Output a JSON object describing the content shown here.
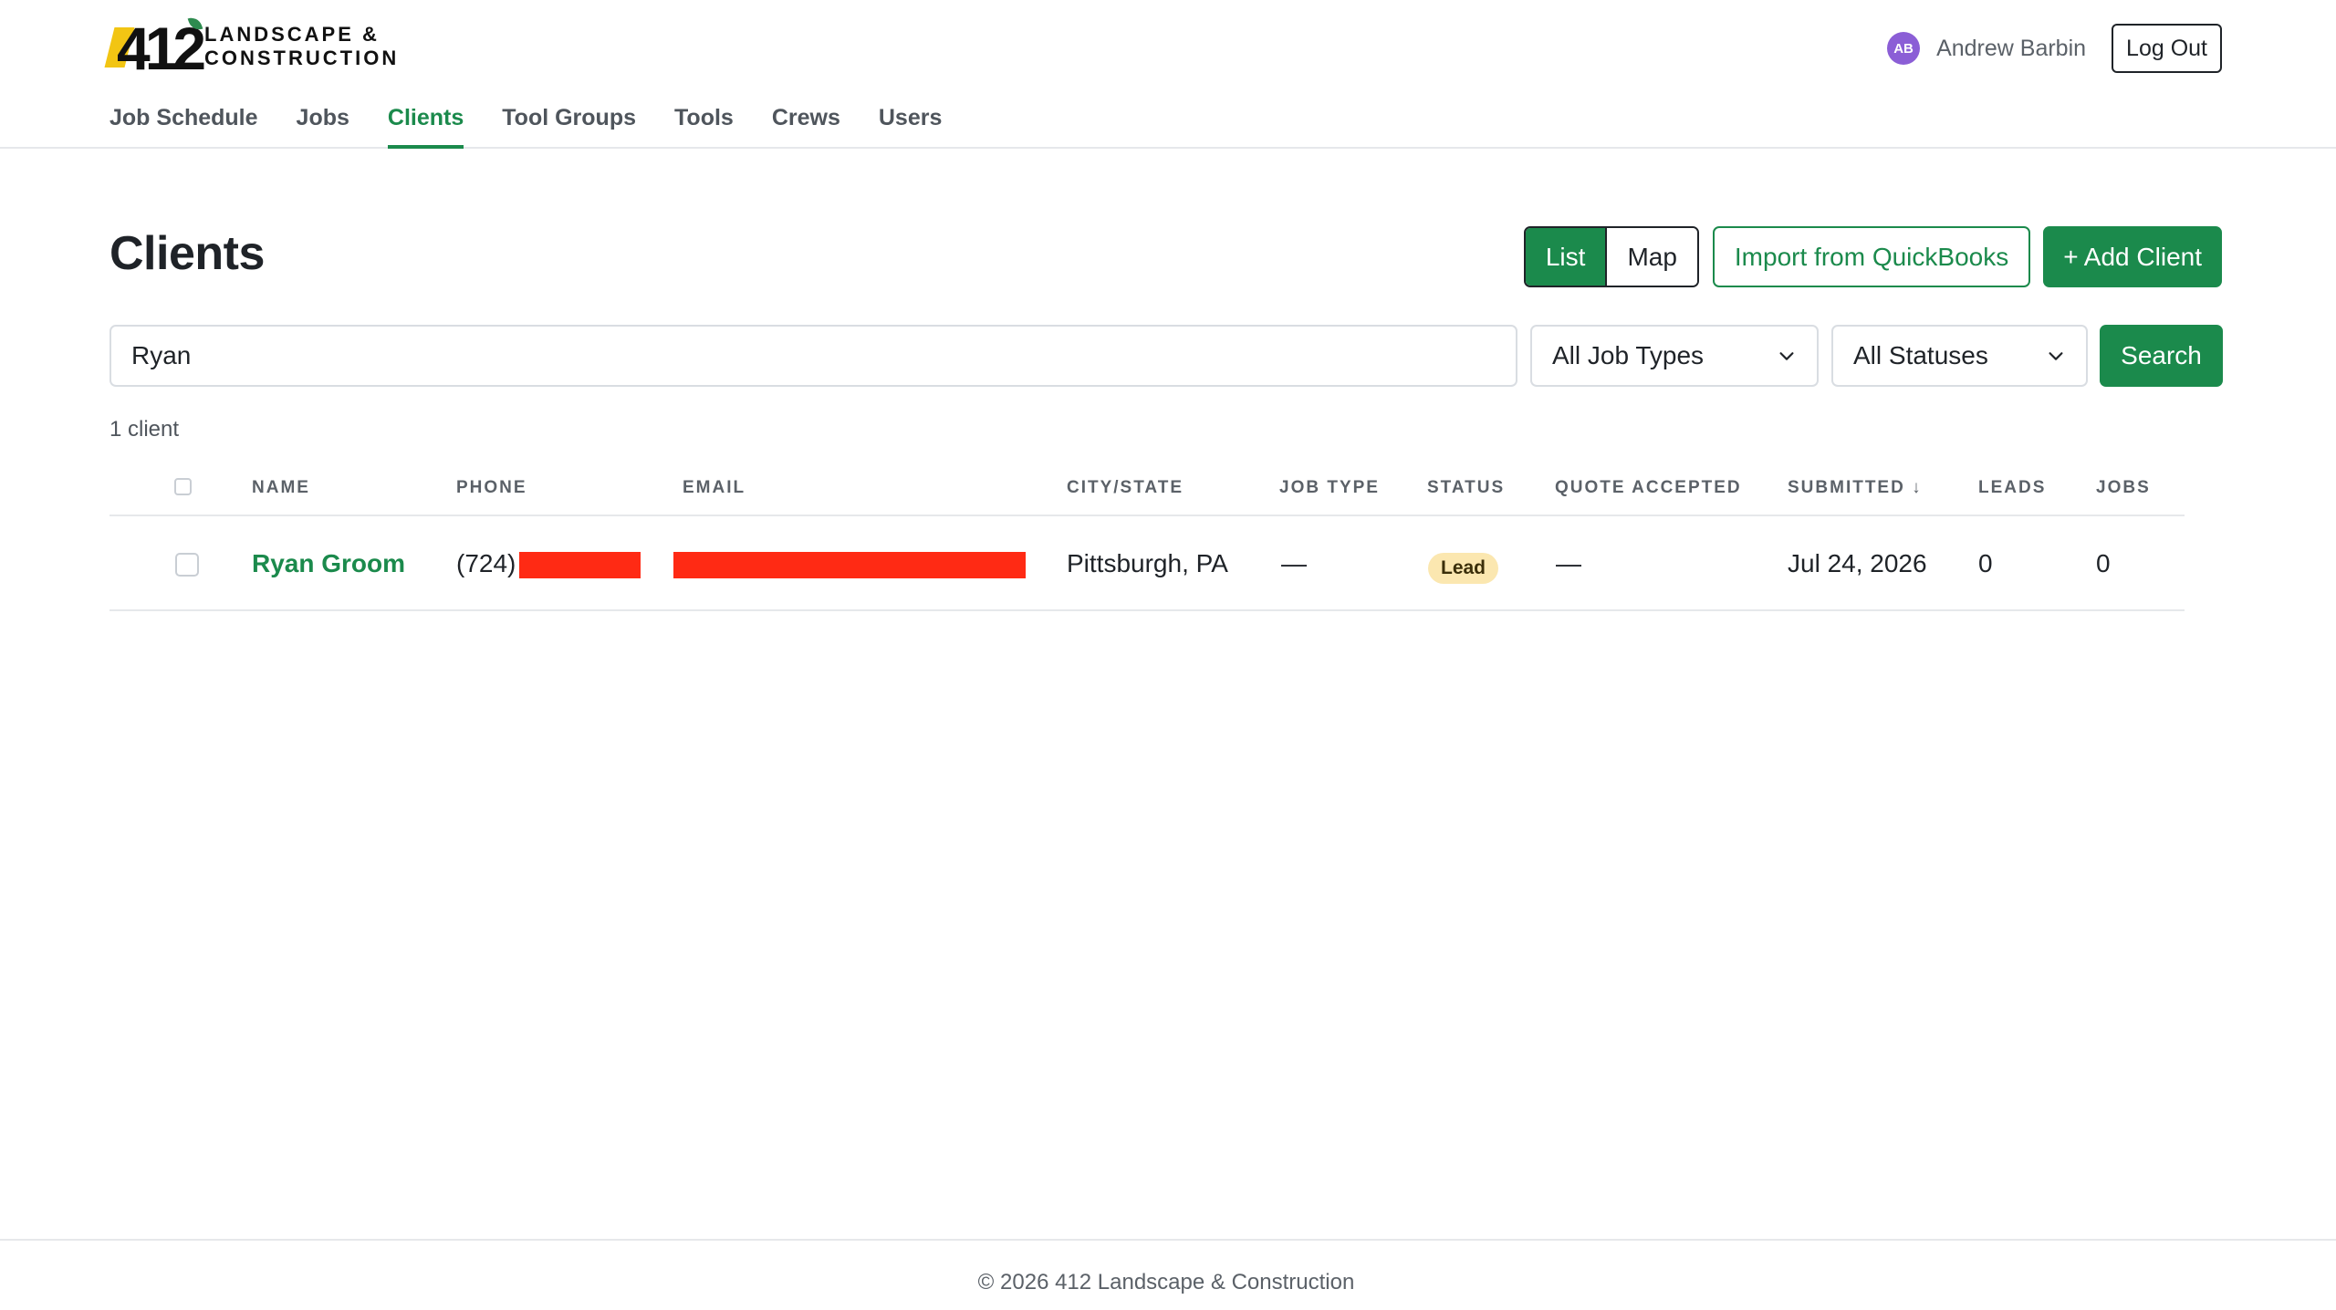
{
  "brand": {
    "logo_number": "412",
    "logo_line1": "LANDSCAPE &",
    "logo_line2": "CONSTRUCTION"
  },
  "user": {
    "initials": "AB",
    "name": "Andrew Barbin",
    "logout_label": "Log Out"
  },
  "nav": {
    "items": [
      "Job Schedule",
      "Jobs",
      "Clients",
      "Tool Groups",
      "Tools",
      "Crews",
      "Users"
    ],
    "active": "Clients"
  },
  "page": {
    "title": "Clients",
    "view_list": "List",
    "view_map": "Map",
    "import_label": "Import from QuickBooks",
    "add_label": "+ Add Client"
  },
  "filters": {
    "search_value": "Ryan",
    "job_type_selected": "All Job Types",
    "status_selected": "All Statuses",
    "search_button": "Search"
  },
  "results": {
    "count_text": "1 client"
  },
  "table": {
    "columns": [
      "NAME",
      "PHONE",
      "EMAIL",
      "CITY/STATE",
      "JOB TYPE",
      "STATUS",
      "QUOTE ACCEPTED",
      "SUBMITTED ↓",
      "LEADS",
      "JOBS"
    ],
    "rows": [
      {
        "name": "Ryan Groom",
        "phone_prefix": "(724)",
        "city_state": "Pittsburgh, PA",
        "job_type": "—",
        "status": "Lead",
        "quote_accepted": "—",
        "submitted": "Jul 24, 2026",
        "leads": "0",
        "jobs": "0"
      }
    ]
  },
  "footer": {
    "text": "© 2026 412 Landscape & Construction"
  },
  "colors": {
    "brand_green": "#1b8a4c",
    "redaction": "#ff2a14",
    "lead_badge": "#fbe7b0",
    "avatar": "#8b5ed6",
    "logo_yellow": "#f2c513"
  }
}
